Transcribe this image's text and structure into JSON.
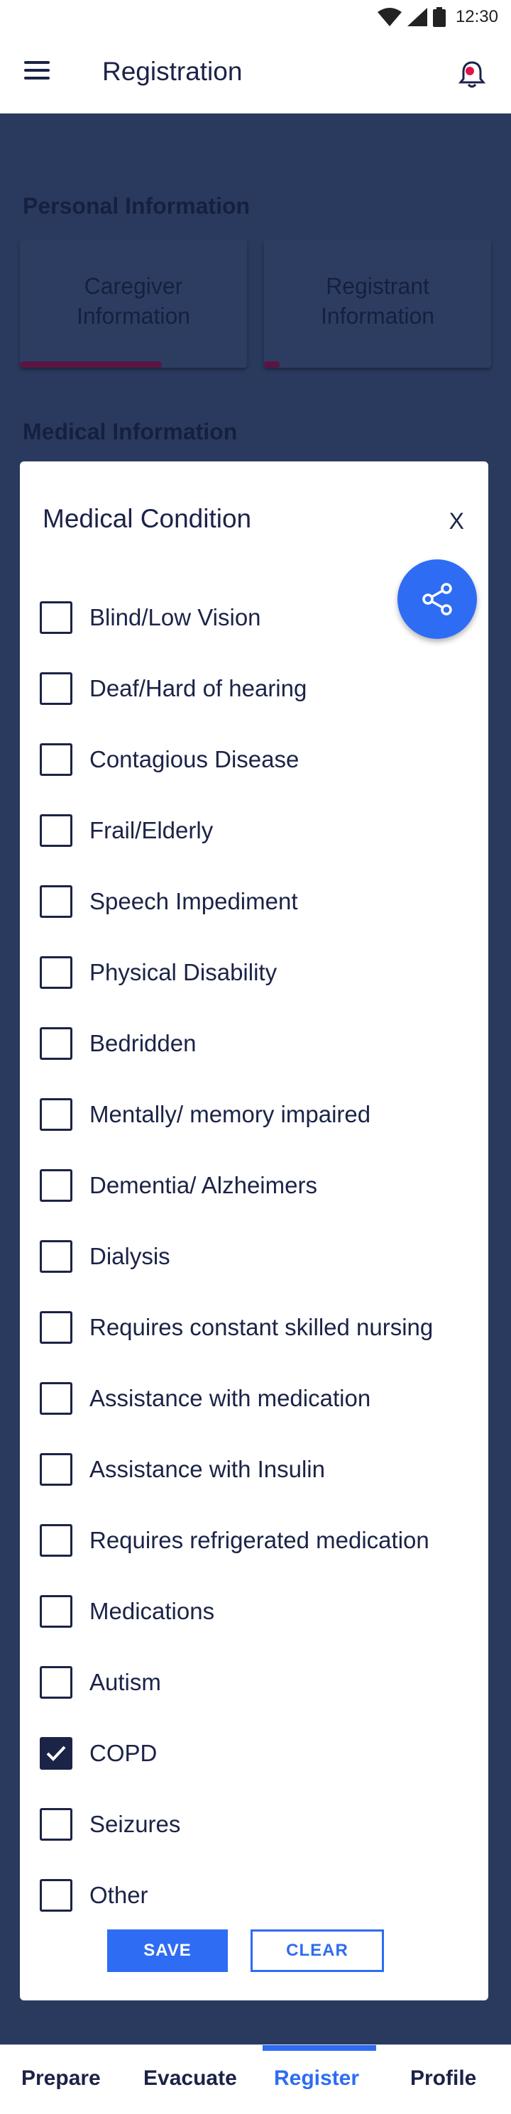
{
  "status_bar": {
    "time": "12:30"
  },
  "app_bar": {
    "title": "Registration"
  },
  "background": {
    "personal_section": "Personal Information",
    "cards": [
      {
        "label": "Caregiver Information"
      },
      {
        "label": "Registrant Information"
      }
    ],
    "medical_section": "Medical Information"
  },
  "modal": {
    "title": "Medical Condition",
    "close_label": "X",
    "options": [
      {
        "label": "Blind/Low Vision",
        "checked": false
      },
      {
        "label": "Deaf/Hard of hearing",
        "checked": false
      },
      {
        "label": "Contagious Disease",
        "checked": false
      },
      {
        "label": "Frail/Elderly",
        "checked": false
      },
      {
        "label": "Speech Impediment",
        "checked": false
      },
      {
        "label": "Physical Disability",
        "checked": false
      },
      {
        "label": "Bedridden",
        "checked": false
      },
      {
        "label": "Mentally/ memory impaired",
        "checked": false
      },
      {
        "label": "Dementia/ Alzheimers",
        "checked": false
      },
      {
        "label": "Dialysis",
        "checked": false
      },
      {
        "label": "Requires constant skilled nursing",
        "checked": false
      },
      {
        "label": "Assistance with medication",
        "checked": false
      },
      {
        "label": "Assistance with Insulin",
        "checked": false
      },
      {
        "label": "Requires refrigerated medication",
        "checked": false
      },
      {
        "label": "Medications",
        "checked": false
      },
      {
        "label": "Autism",
        "checked": false
      },
      {
        "label": "COPD",
        "checked": true
      },
      {
        "label": "Seizures",
        "checked": false
      },
      {
        "label": "Other",
        "checked": false
      }
    ],
    "save_label": "SAVE",
    "clear_label": "CLEAR"
  },
  "bottom_nav": {
    "items": [
      {
        "label": "Prepare",
        "active": false
      },
      {
        "label": "Evacuate",
        "active": false
      },
      {
        "label": "Register",
        "active": true
      },
      {
        "label": "Profile",
        "active": false
      }
    ]
  },
  "colors": {
    "accent": "#2e6cf4",
    "primary_text": "#1b2347",
    "overlay": "#2a3a5e",
    "progress": "#5a1642",
    "notification_dot": "#e0134a"
  }
}
